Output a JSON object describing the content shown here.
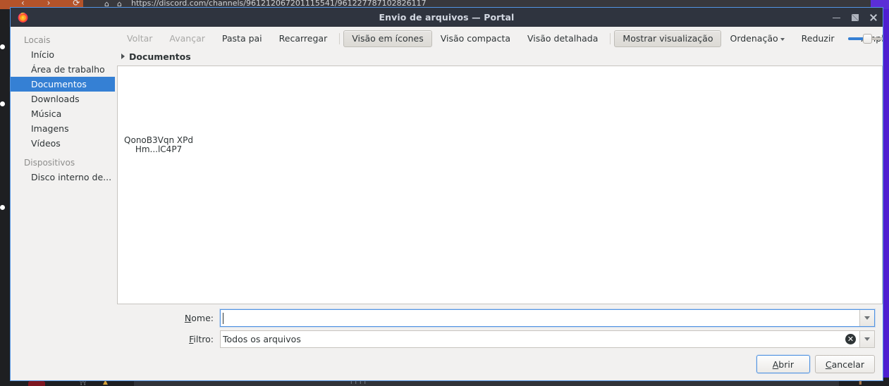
{
  "background": {
    "browser_url": "https://discord.com/channels/961212067201115541/961227787102826117",
    "nav_glyphs": "‹  ›  ⟳",
    "shield_icon": "⌂",
    "lock_icon": "🔒"
  },
  "window": {
    "title": "Envio de arquivos — Portal",
    "app_icon": "firefox-logo",
    "controls": {
      "minimize": "minimize-icon",
      "maximize": "maximize-icon",
      "close": "close-icon"
    }
  },
  "sidebar": {
    "groups": [
      {
        "heading": "Locais",
        "items": [
          {
            "label": "Início",
            "selected": false
          },
          {
            "label": "Área de trabalho",
            "selected": false
          },
          {
            "label": "Documentos",
            "selected": true
          },
          {
            "label": "Downloads",
            "selected": false
          },
          {
            "label": "Música",
            "selected": false
          },
          {
            "label": "Imagens",
            "selected": false
          },
          {
            "label": "Vídeos",
            "selected": false
          }
        ]
      },
      {
        "heading": "Dispositivos",
        "items": [
          {
            "label": "Disco interno de...",
            "selected": false
          }
        ]
      }
    ]
  },
  "toolbar": {
    "back": "Voltar",
    "forward": "Avançar",
    "parent_folder": "Pasta pai",
    "reload": "Recarregar",
    "icon_view": "Visão em ícones",
    "compact_view": "Visão compacta",
    "detailed_view": "Visão detalhada",
    "show_preview": "Mostrar visualização",
    "sort": "Ordenação",
    "zoom_out": "Reduzir",
    "zoom_in": "Ampliar",
    "overflow": "»",
    "zoom_value_percent": 36
  },
  "pathbar": {
    "current_folder": "Documentos",
    "expander": "expander-triangle-icon"
  },
  "fileview": {
    "items": [
      {
        "name": "QonoB3Vqn XPdHm...lC4P7",
        "thumb": "blank-thumbnail"
      }
    ]
  },
  "form": {
    "name": {
      "label_prefix": "N",
      "label_rest": "ome:",
      "value": "",
      "placeholder": ""
    },
    "filter": {
      "label_prefix": "F",
      "label_rest": "iltro:",
      "value": "Todos os arquivos",
      "clear_icon": "clear-circle-icon"
    }
  },
  "buttons": {
    "open_prefix": "A",
    "open_rest": "brir",
    "cancel_prefix": "C",
    "cancel_rest": "ancelar"
  },
  "colors": {
    "accent": "#3580d4",
    "window_border": "#5294e2",
    "titlebar_bg": "#2f343f",
    "dialog_bg": "#f2f1f0"
  }
}
